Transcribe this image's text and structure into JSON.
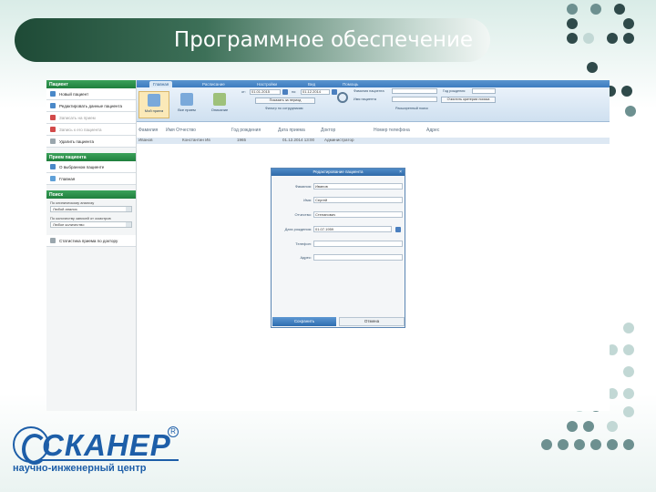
{
  "slide": {
    "title": "Программное обеспечение"
  },
  "app": {
    "ribbon_tabs": [
      "Главная",
      "Расписание",
      "Настройки",
      "Вид",
      "Помощь"
    ],
    "ribbon_buttons": [
      {
        "label": "Мой прием",
        "icon": "calendar-icon"
      },
      {
        "label": "Все прием",
        "icon": "calendar-all-icon"
      },
      {
        "label": "Описание",
        "icon": "document-icon"
      }
    ],
    "period": {
      "from_label": "от:",
      "from_value": "01.01.2015",
      "to_label": "по:",
      "to_value": "01.12.2014",
      "show_button": "Показать за период",
      "filter_label": "Фильтр по сотрудникам"
    },
    "search": {
      "lastname_label": "Фамилия пациента",
      "firstname_label": "Имя пациента",
      "birth_label": "Год рождения",
      "clear_button": "Очистить критерии поиска",
      "advanced_link": "Расширенный поиск"
    },
    "sidebar": {
      "patient_header": "Пациент",
      "patient_items": [
        {
          "label": "Новый пациент",
          "dim": false,
          "icon": "add-patient-icon"
        },
        {
          "label": "Редактировать данные пациента",
          "dim": false,
          "icon": "edit-patient-icon"
        },
        {
          "label": "Записать на прием",
          "dim": true,
          "icon": "appointment-icon"
        },
        {
          "label": "Запись к его пациента",
          "dim": true,
          "icon": "record-icon"
        },
        {
          "label": "Удалить пациента",
          "dim": false,
          "icon": "delete-patient-icon"
        }
      ],
      "recent_header": "Прием пациента",
      "recent_items": [
        {
          "label": "О выбранном пациенте",
          "icon": "info-icon"
        },
        {
          "label": "Главная",
          "icon": "home-icon"
        }
      ],
      "search_header": "Поиск",
      "search_label_1": "По клиническому анализу",
      "search_value_1": "Любой анализ",
      "search_label_2": "По количеству записей от осмотров",
      "search_value_2": "Любое количество",
      "report_item": "Статистика приема по доктору"
    },
    "grid": {
      "columns": [
        "Фамилия",
        "Имя Отчество",
        "Год рождения",
        "Дата приема",
        "Доктор",
        "Номер телефона",
        "Адрес"
      ],
      "row": [
        "Иванов",
        "Константин Ив",
        "1965",
        "01.12.2014 13:00",
        "Администратор",
        "",
        ""
      ]
    },
    "dialog": {
      "title": "Редактирование пациента",
      "fields": [
        {
          "label": "Фамилия:",
          "value": "Иванов"
        },
        {
          "label": "Имя:",
          "value": "Сергей"
        },
        {
          "label": "Отчество:",
          "value": "Степанович"
        },
        {
          "label": "Дата рождения:",
          "value": "01.07.1959"
        },
        {
          "label": "Телефон:",
          "value": ""
        },
        {
          "label": "Адрес:",
          "value": ""
        }
      ],
      "save_button": "Сохранить",
      "cancel_button": "Отмена"
    }
  },
  "logo": {
    "name": "СКАНЕР",
    "registered": "R",
    "subtitle": "научно-инженерный центр"
  },
  "colors": {
    "brand_blue": "#1d5ea8",
    "ribbon_blue": "#3d7cc0",
    "sidebar_green": "#1f7f3d",
    "title_dark_green": "#1e4a36"
  }
}
